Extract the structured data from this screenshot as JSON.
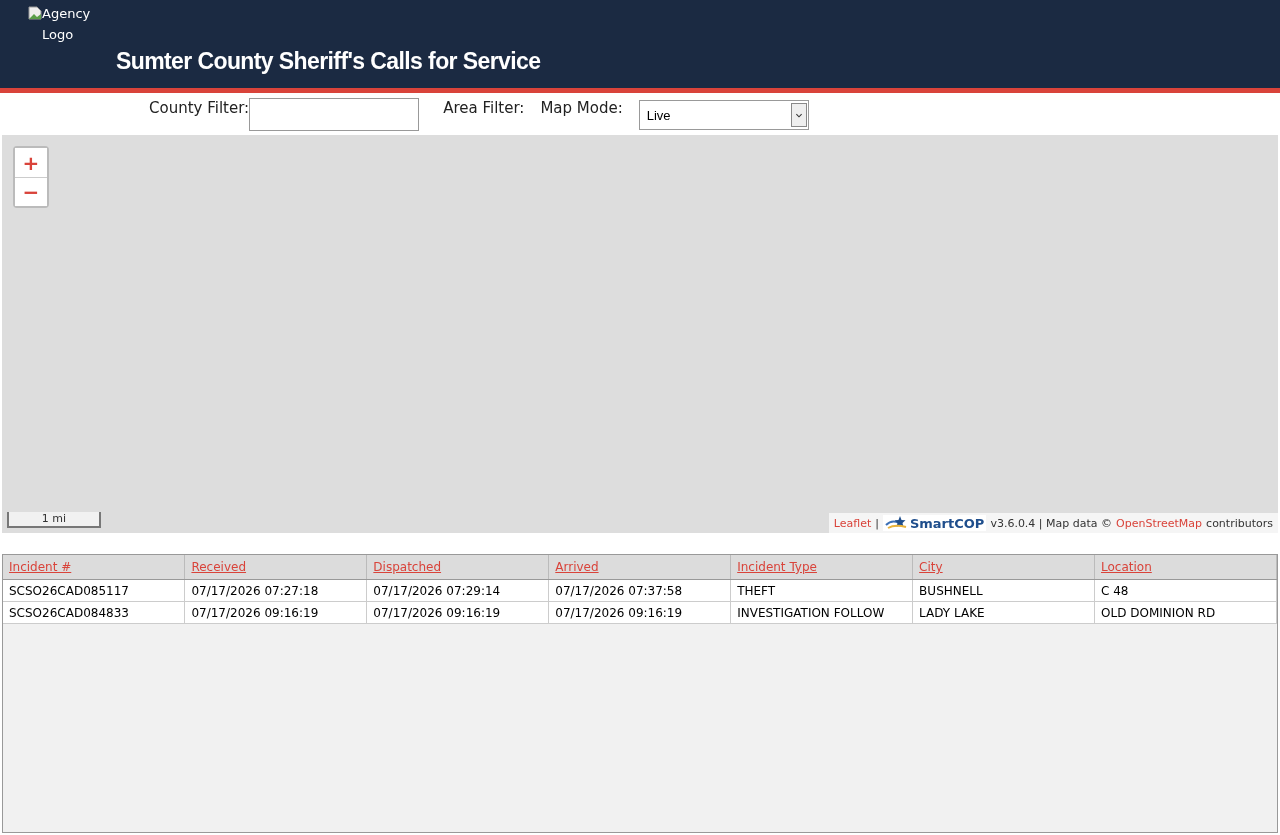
{
  "header": {
    "logo_alt": "Agency Logo",
    "title": "Sumter County Sheriff's Calls for Service"
  },
  "filters": {
    "county_label": "County Filter:",
    "area_label": "Area Filter:",
    "map_mode_label": "Map Mode:",
    "map_mode_value": "Live"
  },
  "map": {
    "zoom_in": "+",
    "zoom_out": "−",
    "scale": "1 mi",
    "attribution": {
      "leaflet": "Leaflet",
      "sep": "|",
      "brand": "SmartCOP",
      "version": "v3.6.0.4 | Map data ©",
      "osm": "OpenStreetMap",
      "tail": "contributors"
    }
  },
  "table": {
    "columns": [
      "Incident #",
      "Received",
      "Dispatched",
      "Arrived",
      "Incident Type",
      "City",
      "Location"
    ],
    "rows": [
      [
        "SCSO26CAD085117",
        "07/17/2026 07:27:18",
        "07/17/2026 07:29:14",
        "07/17/2026 07:37:58",
        "THEFT",
        "BUSHNELL",
        "C 48"
      ],
      [
        "SCSO26CAD084833",
        "07/17/2026 09:16:19",
        "07/17/2026 09:16:19",
        "07/17/2026 09:16:19",
        "INVESTIGATION FOLLOW",
        "LADY LAKE",
        "OLD DOMINION RD"
      ]
    ]
  }
}
